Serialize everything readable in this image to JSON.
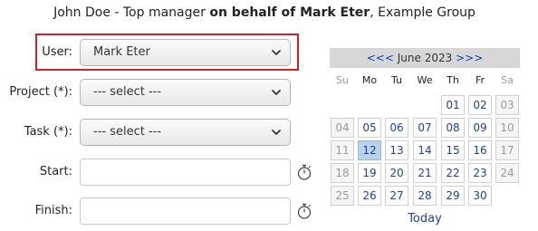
{
  "header": {
    "prefix": "John Doe - Top manager ",
    "bold": "on behalf of Mark Eter",
    "suffix": ", Example Group"
  },
  "form": {
    "user": {
      "label": "User:",
      "value": "Mark Eter"
    },
    "project": {
      "label": "Project (*):",
      "value": "--- select ---"
    },
    "task": {
      "label": "Task (*):",
      "value": "--- select ---"
    },
    "start": {
      "label": "Start:",
      "value": ""
    },
    "finish": {
      "label": "Finish:",
      "value": ""
    }
  },
  "calendar": {
    "prev": "<<<",
    "month": "June 2023",
    "next": ">>>",
    "weekdays": [
      "Su",
      "Mo",
      "Tu",
      "We",
      "Th",
      "Fr",
      "Sa"
    ],
    "weeks": [
      [
        "",
        "",
        "",
        "",
        "01",
        "02",
        "03"
      ],
      [
        "04",
        "05",
        "06",
        "07",
        "08",
        "09",
        "10"
      ],
      [
        "11",
        "12",
        "13",
        "14",
        "15",
        "16",
        "17"
      ],
      [
        "18",
        "19",
        "20",
        "21",
        "22",
        "23",
        "24"
      ],
      [
        "25",
        "26",
        "27",
        "28",
        "29",
        "30",
        ""
      ]
    ],
    "selected": "12",
    "today_label": "Today"
  },
  "colors": {
    "highlight": "#d92020",
    "link": "#1a3fb0",
    "calendar_header": "#d7d7d7",
    "selected_day": "#b9d3ec"
  },
  "icons": {
    "dropdown": "chevron-down-icon",
    "time": "stopwatch-icon"
  }
}
